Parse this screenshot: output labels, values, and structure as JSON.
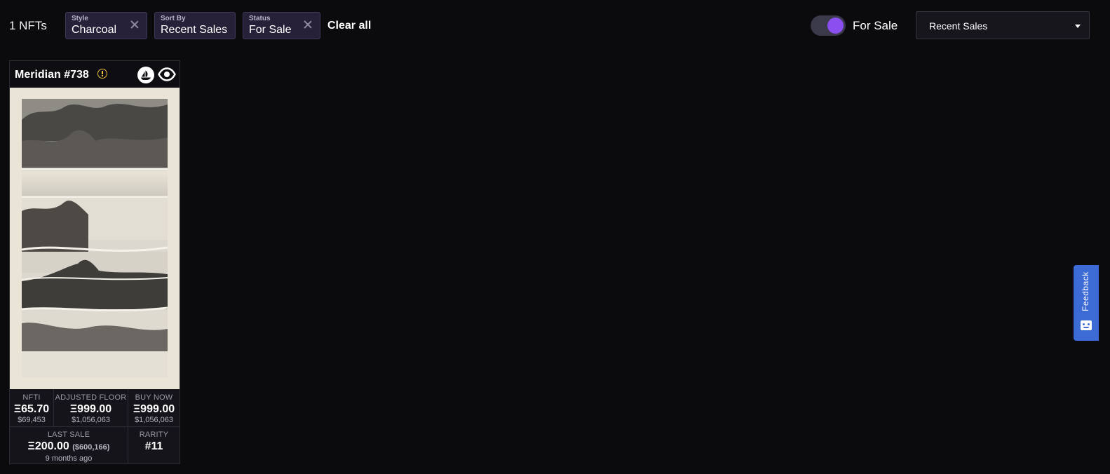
{
  "results": {
    "count_label": "1 NFTs"
  },
  "filters": [
    {
      "label": "Style",
      "value": "Charcoal"
    },
    {
      "label": "Sort By",
      "value": "Recent Sales"
    },
    {
      "label": "Status",
      "value": "For Sale"
    }
  ],
  "clear_all_label": "Clear all",
  "for_sale_toggle": {
    "label": "For Sale",
    "on": true,
    "accent": "#8b4ff0"
  },
  "sort_select": {
    "selected": "Recent Sales"
  },
  "card": {
    "title": "Meridian #738",
    "icons": [
      "warning-icon",
      "opensea-icon",
      "eye-icon"
    ],
    "stats": {
      "nfti": {
        "label": "NFTI",
        "value": "Ξ65.70",
        "usd": "$69,453"
      },
      "adjusted_floor": {
        "label": "ADJUSTED FLOOR",
        "value": "Ξ999.00",
        "usd": "$1,056,063"
      },
      "buy_now": {
        "label": "BUY NOW",
        "value": "Ξ999.00",
        "usd": "$1,056,063"
      },
      "last_sale": {
        "label": "LAST SALE",
        "value": "Ξ200.00",
        "usd": "($600,166)",
        "time": "9 months ago"
      },
      "rarity": {
        "label": "RARITY",
        "value": "#11"
      }
    }
  },
  "feedback": {
    "label": "Feedback",
    "color": "#3d6bd6"
  }
}
